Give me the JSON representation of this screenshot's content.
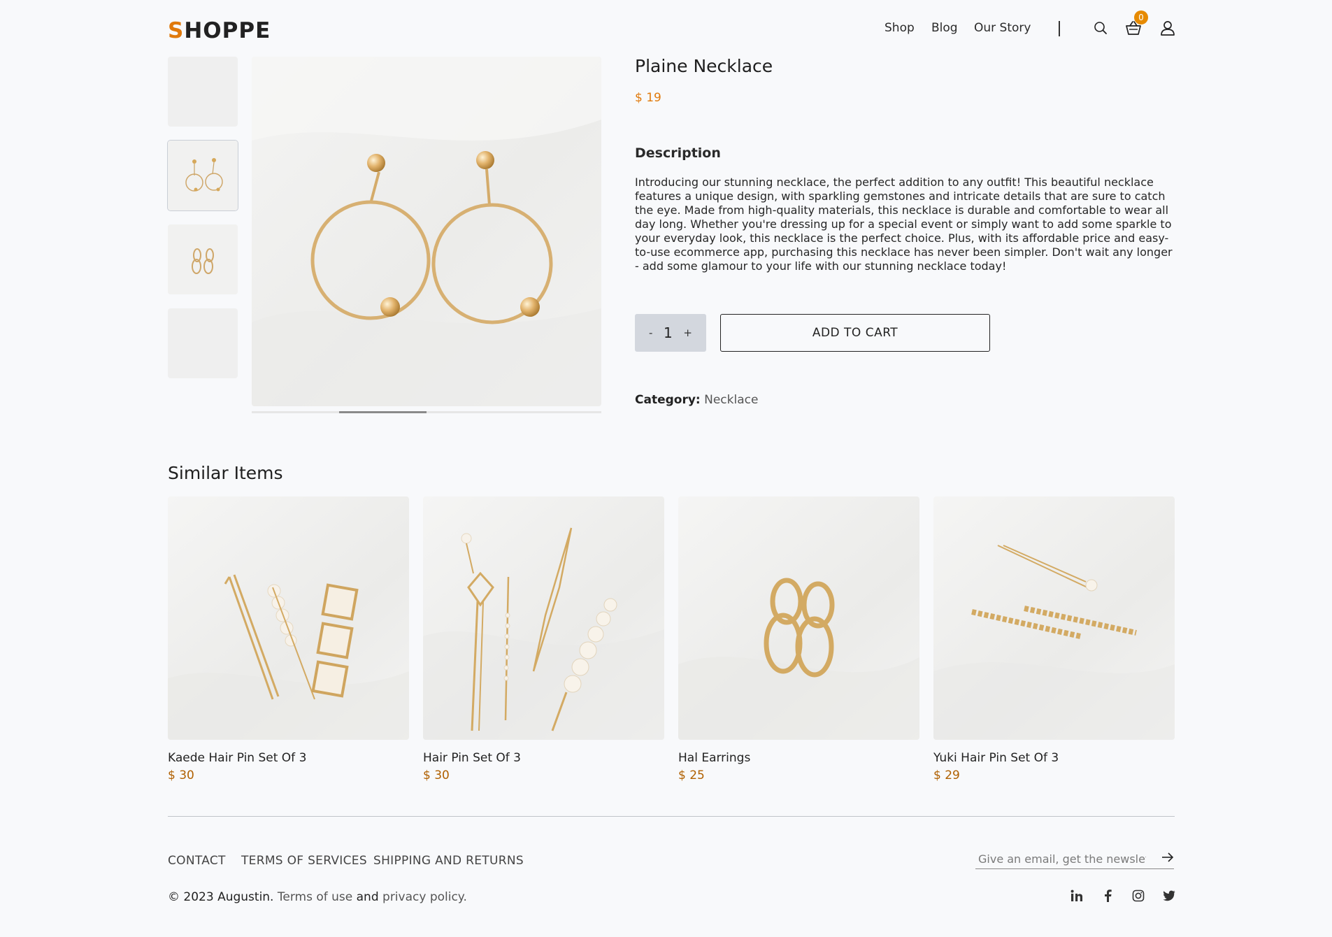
{
  "header": {
    "logo_first": "S",
    "logo_rest": "HOPPE",
    "nav": [
      "Shop",
      "Blog",
      "Our Story"
    ],
    "cart_count": "0"
  },
  "product": {
    "title": "Plaine Necklace",
    "price": "$ 19",
    "description_heading": "Description",
    "description": "Introducing our stunning necklace, the perfect addition to any outfit! This beautiful necklace features a unique design, with sparkling gemstones and intricate details that are sure to catch the eye. Made from high-quality materials, this necklace is durable and comfortable to wear all day long. Whether you're dressing up for a special event or simply want to add some sparkle to your everyday look, this necklace is the perfect choice. Plus, with its affordable price and easy-to-use ecommerce app, purchasing this necklace has never been simpler. Don't wait any longer - add some glamour to your life with our stunning necklace today!",
    "qty_minus": "-",
    "qty_value": "1",
    "qty_plus": "+",
    "add_to_cart": "ADD TO CART",
    "category_label": "Category:",
    "category_value": "Necklace"
  },
  "similar": {
    "heading": "Similar Items",
    "items": [
      {
        "name": "Kaede Hair Pin Set Of 3",
        "price": "$ 30"
      },
      {
        "name": "Hair Pin Set Of 3",
        "price": "$ 30"
      },
      {
        "name": "Hal Earrings",
        "price": "$ 25"
      },
      {
        "name": "Yuki Hair Pin Set Of 3",
        "price": "$ 29"
      }
    ]
  },
  "footer": {
    "links": [
      "CONTACT",
      "TERMS OF SERVICES",
      "SHIPPING AND RETURNS"
    ],
    "newsletter_placeholder": "Give an email, get the newsletter",
    "copyright": "© 2023 Augustin.",
    "terms": "Terms of use",
    "and": "and",
    "privacy": "privacy policy."
  },
  "colors": {
    "accent": "#e07a0c",
    "price_dark": "#b06000",
    "qty_bg": "#d3d7de",
    "background": "#f8f9fb"
  }
}
